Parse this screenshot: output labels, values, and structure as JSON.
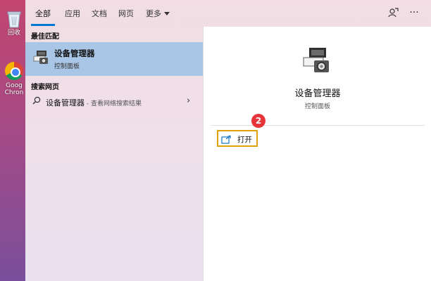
{
  "desktop": {
    "recycle_label": "回收",
    "chrome_label_1": "Goog",
    "chrome_label_2": "Chron"
  },
  "tabs": [
    {
      "label": "全部",
      "active": true
    },
    {
      "label": "应用"
    },
    {
      "label": "文档"
    },
    {
      "label": "网页"
    },
    {
      "label": "更多"
    }
  ],
  "left": {
    "best_match_heading": "最佳匹配",
    "best_match": {
      "title": "设备管理器",
      "subtitle": "控制面板"
    },
    "web_heading": "搜索网页",
    "web_result": {
      "query": "设备管理器",
      "suffix": " - 查看网络搜索结果"
    }
  },
  "detail": {
    "title": "设备管理器",
    "subtitle": "控制面板",
    "open_label": "打开",
    "step_badge": "2"
  },
  "colors": {
    "selected_row": "#a9c6e6",
    "highlight_border": "#e0a20a",
    "badge": "#e5353a",
    "tab_underline": "#0078d4"
  }
}
